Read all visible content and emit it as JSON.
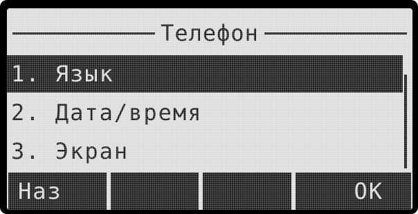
{
  "header": {
    "title": "Телефон"
  },
  "menu": {
    "items": [
      {
        "label": "1. Язык",
        "selected": true
      },
      {
        "label": "2. Дата/время",
        "selected": false
      },
      {
        "label": "3. Экран",
        "selected": false
      }
    ]
  },
  "softkeys": {
    "key1": "Наз",
    "key2": "",
    "key3": "",
    "key4": "OK"
  },
  "colors": {
    "lcd_background": "#dcdcdc",
    "lcd_foreground": "#1a1a1a",
    "bezel": "#000000"
  }
}
